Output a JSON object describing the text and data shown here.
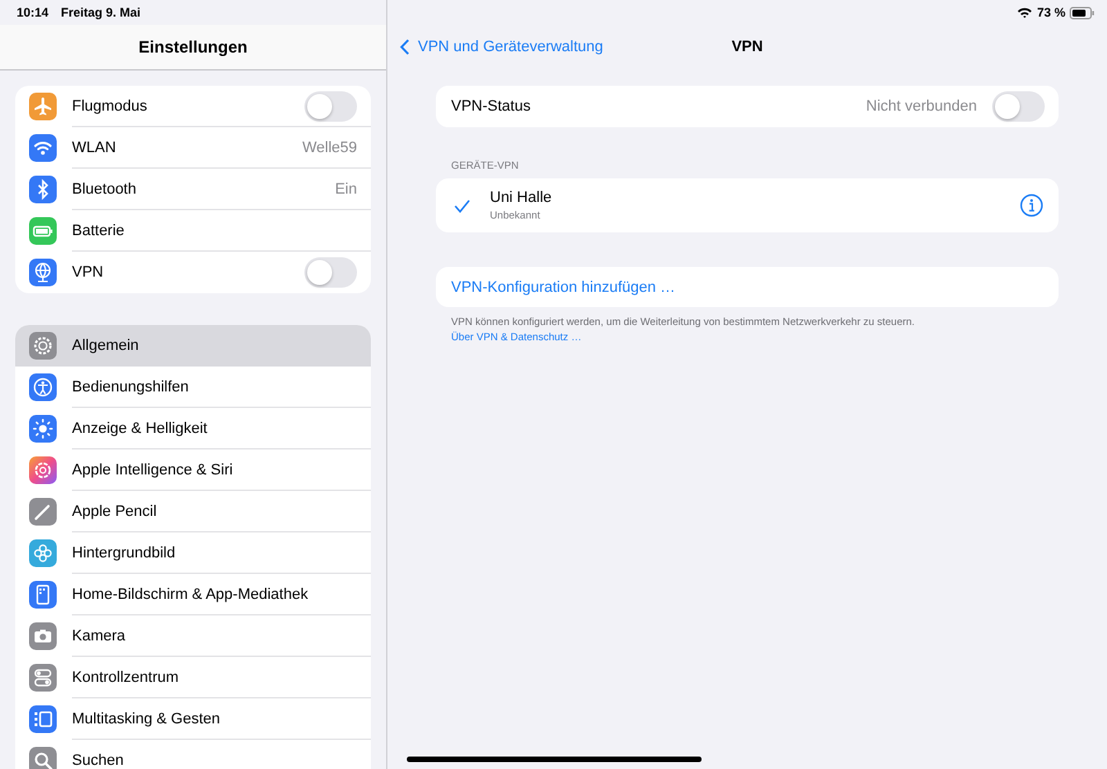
{
  "status_bar": {
    "time": "10:14",
    "date": "Freitag 9. Mai",
    "battery_level": "73 %"
  },
  "sidebar": {
    "title": "Einstellungen",
    "groups": [
      {
        "items": [
          {
            "label": "Flugmodus",
            "kind": "toggle",
            "on": false,
            "selected": false
          },
          {
            "label": "WLAN",
            "kind": "value",
            "value": "Welle59",
            "selected": false
          },
          {
            "label": "Bluetooth",
            "kind": "value",
            "value": "Ein",
            "selected": false
          },
          {
            "label": "Batterie",
            "kind": "plain",
            "selected": false
          },
          {
            "label": "VPN",
            "kind": "toggle",
            "on": false,
            "selected": false
          }
        ]
      },
      {
        "items": [
          {
            "label": "Allgemein",
            "kind": "plain",
            "selected": true
          },
          {
            "label": "Bedienungshilfen",
            "kind": "plain",
            "selected": false
          },
          {
            "label": "Anzeige & Helligkeit",
            "kind": "plain",
            "selected": false
          },
          {
            "label": "Apple Intelligence & Siri",
            "kind": "plain",
            "selected": false
          },
          {
            "label": "Apple Pencil",
            "kind": "plain",
            "selected": false
          },
          {
            "label": "Hintergrundbild",
            "kind": "plain",
            "selected": false
          },
          {
            "label": "Home-Bildschirm & App-Mediathek",
            "kind": "plain",
            "selected": false
          },
          {
            "label": "Kamera",
            "kind": "plain",
            "selected": false
          },
          {
            "label": "Kontrollzentrum",
            "kind": "plain",
            "selected": false
          },
          {
            "label": "Multitasking & Gesten",
            "kind": "plain",
            "selected": false
          },
          {
            "label": "Suchen",
            "kind": "plain",
            "selected": false
          }
        ]
      }
    ]
  },
  "detail": {
    "back": "VPN und Geräteverwaltung",
    "title": "VPN",
    "status": {
      "label": "VPN-Status",
      "value": "Nicht verbunden",
      "on": false
    },
    "section_header": "GERÄTE-VPN",
    "configs": [
      {
        "name": "Uni Halle",
        "status": "Unbekannt",
        "selected": true
      }
    ],
    "add_config": "VPN-Konfiguration hinzufügen …",
    "footer": "VPN können konfiguriert werden, um die Weiterleitung von bestimmtem Netzwerkverkehr zu steuern.",
    "footer_link": "Über VPN & Datenschutz …"
  }
}
